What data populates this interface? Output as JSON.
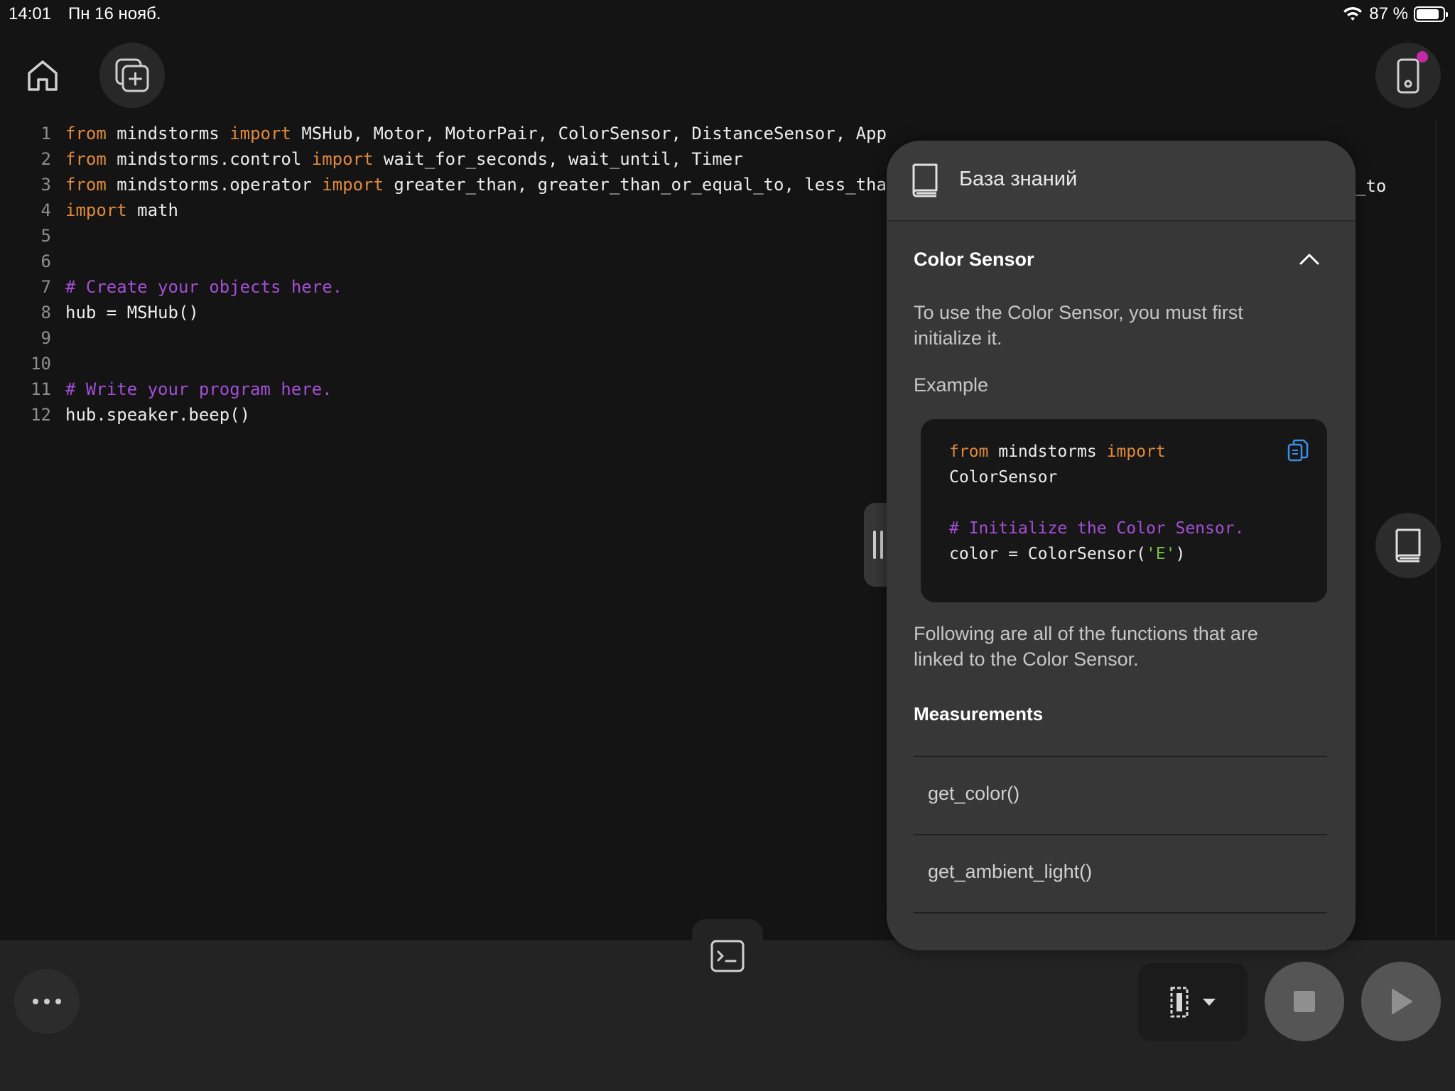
{
  "status_bar": {
    "time": "14:01",
    "date": "Пн 16 нояб.",
    "battery_percent": "87 %",
    "battery_level": 0.87
  },
  "toolbar": {
    "home_icon": "home-icon",
    "new_project_icon": "add-project-icon",
    "hub_icon": "hub-connection-icon"
  },
  "editor": {
    "lines": [
      {
        "n": "1",
        "segments": [
          {
            "t": "from",
            "c": "kw"
          },
          {
            "t": " mindstorms ",
            "c": "tx"
          },
          {
            "t": "import",
            "c": "kw"
          },
          {
            "t": " MSHub, Motor, MotorPair, ColorSensor, DistanceSensor, App",
            "c": "tx"
          }
        ]
      },
      {
        "n": "2",
        "segments": [
          {
            "t": "from",
            "c": "kw"
          },
          {
            "t": " mindstorms.control ",
            "c": "tx"
          },
          {
            "t": "import",
            "c": "kw"
          },
          {
            "t": " wait_for_seconds, wait_until, Timer",
            "c": "tx"
          }
        ]
      },
      {
        "n": "3",
        "segments": [
          {
            "t": "from",
            "c": "kw"
          },
          {
            "t": " mindstorms.operator ",
            "c": "tx"
          },
          {
            "t": "import",
            "c": "kw"
          },
          {
            "t": " greater_than, greater_than_or_equal_to, less_tha",
            "c": "tx"
          }
        ]
      },
      {
        "n": "4",
        "segments": [
          {
            "t": "import",
            "c": "kw"
          },
          {
            "t": " math",
            "c": "tx"
          }
        ]
      },
      {
        "n": "5",
        "segments": []
      },
      {
        "n": "6",
        "segments": []
      },
      {
        "n": "7",
        "segments": [
          {
            "t": "# Create your objects here.",
            "c": "cm"
          }
        ]
      },
      {
        "n": "8",
        "segments": [
          {
            "t": "hub = MSHub()",
            "c": "tx"
          }
        ]
      },
      {
        "n": "9",
        "segments": []
      },
      {
        "n": "10",
        "segments": []
      },
      {
        "n": "11",
        "segments": [
          {
            "t": "# Write your program here.",
            "c": "cm"
          }
        ]
      },
      {
        "n": "12",
        "segments": [
          {
            "t": "hub.speaker.beep()",
            "c": "tx"
          }
        ]
      }
    ],
    "line3_overflow_text": "_to"
  },
  "knowledge_base": {
    "title": "База знаний",
    "section_title": "Color Sensor",
    "intro": "To use the Color Sensor, you must first initialize it.",
    "example_label": "Example",
    "code": {
      "line1_kw1": "from",
      "line1_mid": " mindstorms ",
      "line1_kw2": "import",
      "line2": "ColorSensor",
      "comment": "# Initialize the Color Sensor.",
      "line4_pre": "color = ColorSensor(",
      "line4_str": "'E'",
      "line4_post": ")"
    },
    "functions_intro": "Following are all of the functions that are linked to the Color Sensor.",
    "measurements_title": "Measurements",
    "functions": [
      "get_color()",
      "get_ambient_light()"
    ]
  },
  "colors": {
    "keyword": "#e0893d",
    "comment": "#a34fd4",
    "string": "#71c442",
    "accent_blue": "#3d8ee6",
    "notification_dot": "#c42aa8"
  }
}
